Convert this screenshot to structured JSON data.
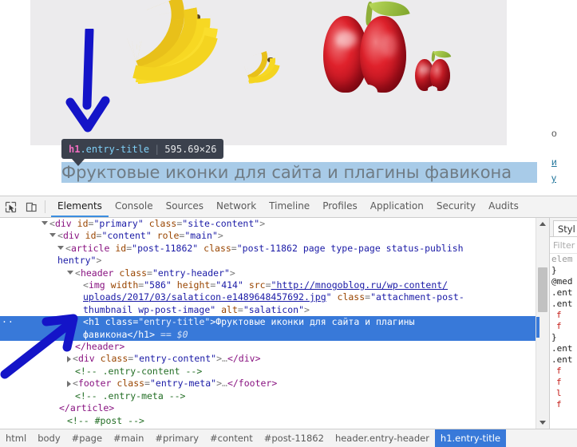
{
  "page": {
    "inspect_tooltip": {
      "tag": "h1",
      "class_sel": ".entry-title",
      "separator": "|",
      "dimensions": "595.69×26"
    },
    "h1_title": "Фруктовые иконки для сайта и плагины фавикона",
    "right_column_clipped": [
      "о",
      "и",
      "у"
    ]
  },
  "devtools": {
    "toolbar": {
      "inspect_icon": "inspect-cursor-icon",
      "device_icon": "device-toolbar-icon",
      "tabs": [
        {
          "label": "Elements",
          "active": true
        },
        {
          "label": "Console",
          "active": false
        },
        {
          "label": "Sources",
          "active": false
        },
        {
          "label": "Network",
          "active": false
        },
        {
          "label": "Timeline",
          "active": false
        },
        {
          "label": "Profiles",
          "active": false
        },
        {
          "label": "Application",
          "active": false
        },
        {
          "label": "Security",
          "active": false
        },
        {
          "label": "Audits",
          "active": false
        }
      ]
    },
    "dom": {
      "l1": {
        "tag_open": "<div",
        "attr1": "id",
        "val1": "\"primary\"",
        "attr2": "class",
        "val2": "\"site-content\"",
        "close": ">"
      },
      "l2": {
        "tag_open": "<div",
        "attr1": "id",
        "val1": "\"content\"",
        "attr2": "role",
        "val2": "\"main\"",
        "close": ">"
      },
      "l3": {
        "tag_open": "<article",
        "attr1": "id",
        "val1": "\"post-11862\"",
        "attr2": "class",
        "val2": "\"post-11862 page type-page status-publish",
        "close": ""
      },
      "l3b": {
        "val_cont": "hentry\"",
        "close": ">"
      },
      "l4": {
        "tag_open": "<header",
        "attr1": "class",
        "val1": "\"entry-header\"",
        "close": ">"
      },
      "l5": {
        "tag_open": "<img",
        "attr1": "width",
        "val1": "\"586\"",
        "attr2": "height",
        "val2": "\"414\"",
        "attr3": "src",
        "val3_a": "\"http://mnogoblog.ru/wp-content/"
      },
      "l5b": {
        "val3_b": "uploads/2017/03/salaticon-e1489648457692.jpg",
        "val3_c": "\"",
        "attr4": "class",
        "val4_a": "\"attachment-post-"
      },
      "l5c": {
        "val4_b": "thumbnail wp-post-image\"",
        "attr5": "alt",
        "val5": "\"salaticon\"",
        "close": ">"
      },
      "l6": {
        "tag_open": "<h1",
        "attr1": "class",
        "val1": "\"entry-title\"",
        "close": ">",
        "text": "Фруктовые иконки для сайта и плагины"
      },
      "l6b": {
        "text_cont": "фавикона",
        "tag_close": "</h1>",
        "dollar": "== $0"
      },
      "l7": {
        "tag_close": "</header>"
      },
      "l8": {
        "tag_open": "<div",
        "attr1": "class",
        "val1": "\"entry-content\"",
        "close": ">",
        "ellipsis": "…",
        "tag_close": "</div>"
      },
      "l9": {
        "comment": "<!-- .entry-content -->"
      },
      "l10": {
        "tag_open": "<footer",
        "attr1": "class",
        "val1": "\"entry-meta\"",
        "close": ">",
        "ellipsis": "…",
        "tag_close": "</footer>"
      },
      "l11": {
        "comment": "<!-- .entry-meta -->"
      },
      "l12": {
        "tag_close": "</article>"
      },
      "l13": {
        "comment": "<!-- #post -->"
      }
    },
    "styles_pane": {
      "tab_label": "Styl",
      "filter_placeholder": "Filter",
      "lines": [
        "elem",
        "}",
        "@med",
        ".ent",
        ".ent",
        "f",
        "f",
        "}",
        ".ent",
        ".ent",
        "f",
        "f",
        "l",
        "f"
      ]
    },
    "breadcrumbs": [
      {
        "label": "html",
        "active": false
      },
      {
        "label": "body",
        "active": false
      },
      {
        "label": "#page",
        "active": false
      },
      {
        "label": "#main",
        "active": false
      },
      {
        "label": "#primary",
        "active": false
      },
      {
        "label": "#content",
        "active": false
      },
      {
        "label": "#post-11862",
        "active": false
      },
      {
        "label": "header.entry-header",
        "active": false
      },
      {
        "label": "h1.entry-title",
        "active": true
      }
    ]
  },
  "colors": {
    "selection_blue": "#3879d9",
    "accent_tab": "#3b8ee0",
    "tooltip_bg": "#3b414d",
    "annotation_arrow": "#1414c8",
    "h1_highlight": "#a8cbe8"
  }
}
